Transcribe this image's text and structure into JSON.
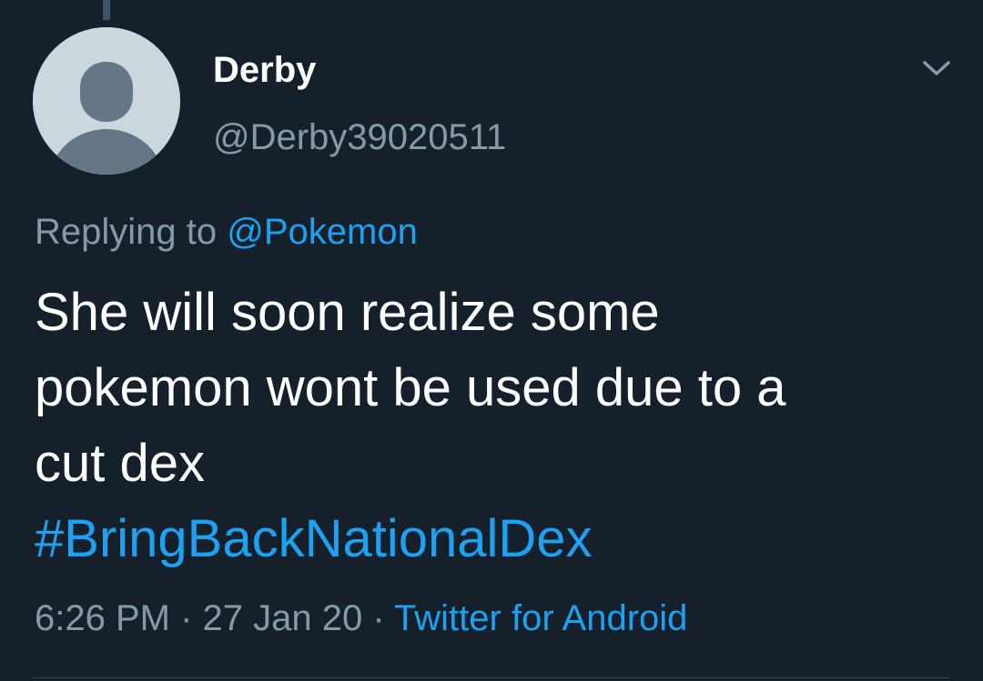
{
  "tweet": {
    "author": {
      "display_name": "Derby",
      "handle": "@Derby39020511",
      "avatar_icon": "default-avatar-icon"
    },
    "menu_icon": "chevron-down-icon",
    "reply_context": {
      "prefix": "Replying to ",
      "mention": "@Pokemon"
    },
    "text_lines": [
      "She will soon realize some",
      "pokemon wont be used due to a",
      "cut dex"
    ],
    "hashtag": "#BringBackNationalDex",
    "time": "6:26 PM",
    "separator": " · ",
    "date": "27 Jan 20",
    "source": "Twitter for Android"
  },
  "colors": {
    "background": "#15202b",
    "primary_text": "#ffffff",
    "secondary_text": "#8899a6",
    "accent": "#1da1f2"
  }
}
